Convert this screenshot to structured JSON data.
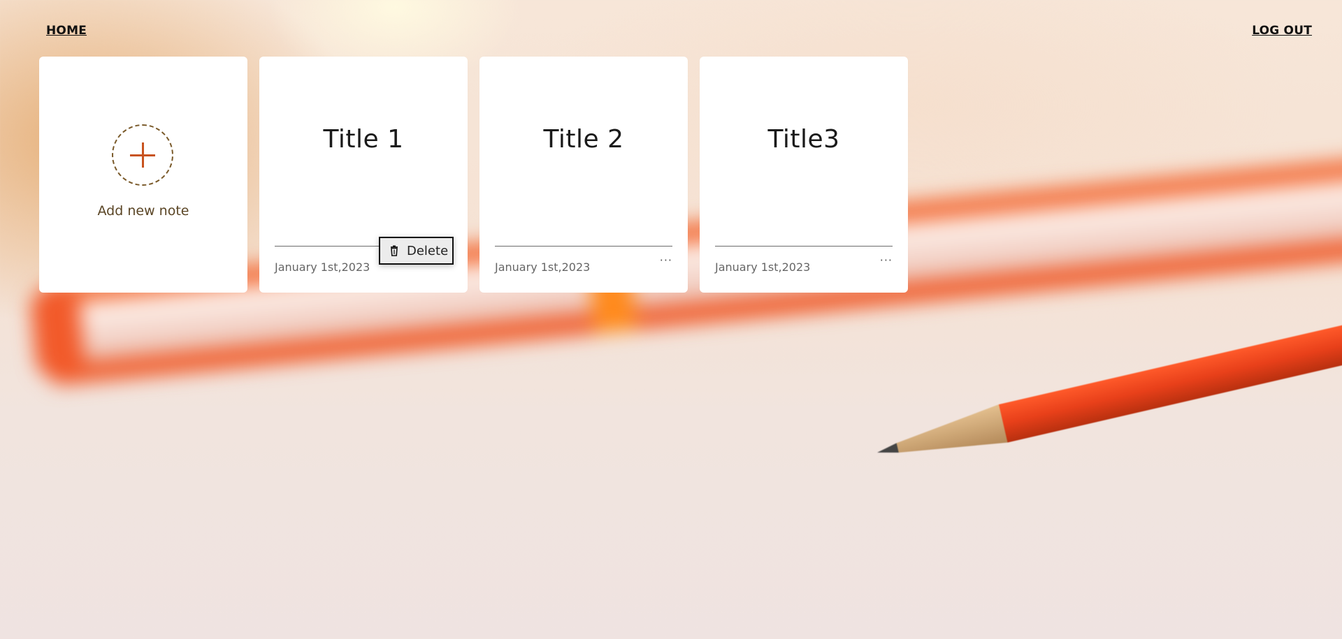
{
  "header": {
    "home_label": "HOME",
    "logout_label": "LOG OUT"
  },
  "add_note": {
    "label": "Add new note",
    "icon": "plus-icon"
  },
  "notes": [
    {
      "title": "Title 1",
      "date": "January 1st,2023",
      "menu_open": true
    },
    {
      "title": "Title 2",
      "date": "January 1st,2023",
      "menu_open": false
    },
    {
      "title": "Title3",
      "date": "January 1st,2023",
      "menu_open": false
    }
  ],
  "note_menu": {
    "delete_label": "Delete",
    "delete_icon": "trash-icon",
    "more_icon": "ellipsis-icon",
    "more_glyph": "···"
  },
  "colors": {
    "accent": "#c8531f",
    "add_border": "#7a5a2a",
    "card_bg": "#ffffff"
  }
}
